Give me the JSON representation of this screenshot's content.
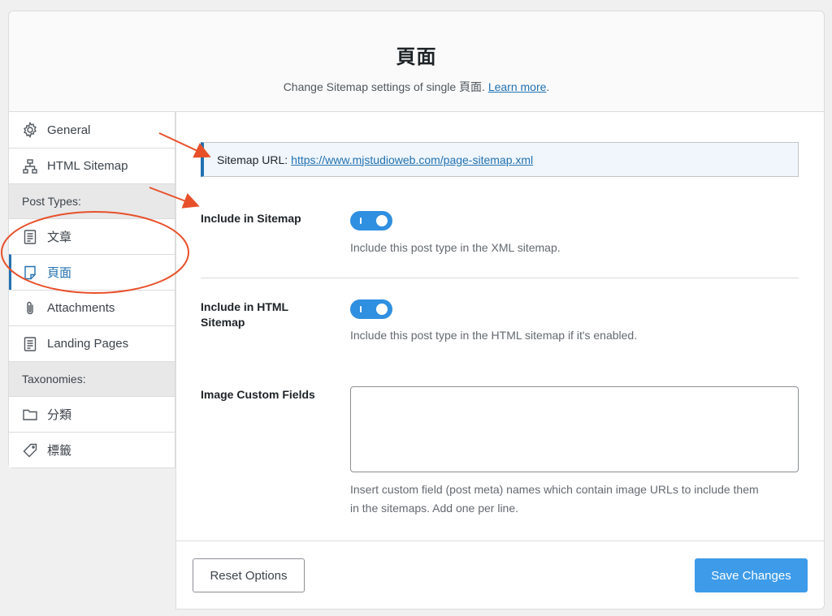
{
  "header": {
    "title": "頁面",
    "subtitle_text": "Change Sitemap settings of single 頁面.",
    "learn_more": "Learn more",
    "subtitle_end": "."
  },
  "sidebar": {
    "items": [
      {
        "label": "General",
        "icon": "gear-icon"
      },
      {
        "label": "HTML Sitemap",
        "icon": "sitemap-icon"
      }
    ],
    "post_types_heading": "Post Types:",
    "post_types": [
      {
        "label": "文章",
        "icon": "document-icon"
      },
      {
        "label": "頁面",
        "icon": "page-icon",
        "active": true
      },
      {
        "label": "Attachments",
        "icon": "paperclip-icon"
      },
      {
        "label": "Landing Pages",
        "icon": "document-icon"
      }
    ],
    "taxonomies_heading": "Taxonomies:",
    "taxonomies": [
      {
        "label": "分類",
        "icon": "folder-icon"
      },
      {
        "label": "標籤",
        "icon": "tag-icon"
      }
    ]
  },
  "main": {
    "sitemap_url_label": "Sitemap URL:",
    "sitemap_url": "https://www.mjstudioweb.com/page-sitemap.xml",
    "include_sitemap": {
      "label": "Include in Sitemap",
      "enabled": true,
      "description": "Include this post type in the XML sitemap."
    },
    "include_html_sitemap": {
      "label": "Include in HTML Sitemap",
      "enabled": true,
      "description": "Include this post type in the HTML sitemap if it's enabled."
    },
    "image_custom_fields": {
      "label": "Image Custom Fields",
      "value": "",
      "description_line1": "Insert custom field (post meta) names which contain image URLs to include them",
      "description_line2": "in the sitemaps. Add one per line."
    }
  },
  "footer": {
    "reset_label": "Reset Options",
    "save_label": "Save Changes"
  },
  "colors": {
    "accent": "#2271b1",
    "toggle_on": "#2f8fe0",
    "save_button": "#3d9be9",
    "annotation": "#e8502a"
  }
}
